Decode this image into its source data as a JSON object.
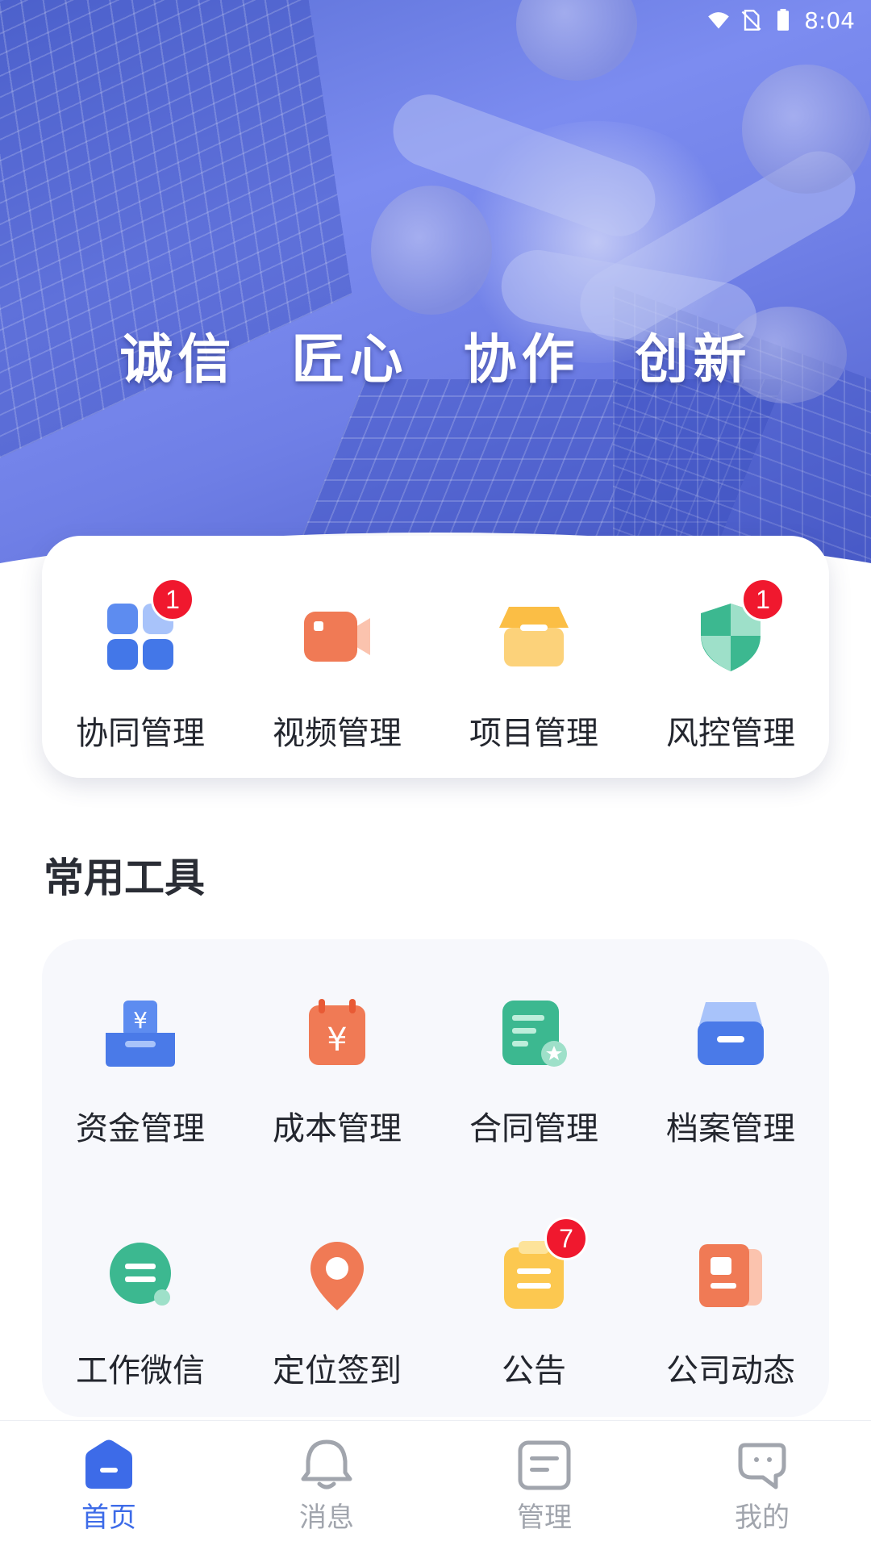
{
  "status_bar": {
    "time": "8:04"
  },
  "banner": {
    "slogan": "诚信 匠心 协作 创新"
  },
  "top_card": {
    "items": [
      {
        "label": "协同管理",
        "icon": "apps-grid-icon",
        "badge": "1"
      },
      {
        "label": "视频管理",
        "icon": "video-camera-icon"
      },
      {
        "label": "项目管理",
        "icon": "store-icon"
      },
      {
        "label": "风控管理",
        "icon": "shield-icon",
        "badge": "1"
      }
    ]
  },
  "section": {
    "title": "常用工具"
  },
  "tools": {
    "items": [
      {
        "label": "资金管理",
        "icon": "funds-yen-tray-icon"
      },
      {
        "label": "成本管理",
        "icon": "cost-yen-calendar-icon"
      },
      {
        "label": "合同管理",
        "icon": "contract-document-icon"
      },
      {
        "label": "档案管理",
        "icon": "archive-box-icon"
      },
      {
        "label": "工作微信",
        "icon": "chat-bubble-icon"
      },
      {
        "label": "定位签到",
        "icon": "location-pin-icon"
      },
      {
        "label": "公告",
        "icon": "notice-clipboard-icon",
        "badge": "7"
      },
      {
        "label": "公司动态",
        "icon": "company-news-icon"
      }
    ]
  },
  "bottom_nav": {
    "items": [
      {
        "label": "首页",
        "icon": "home-icon",
        "active": true
      },
      {
        "label": "消息",
        "icon": "bell-icon"
      },
      {
        "label": "管理",
        "icon": "management-card-icon"
      },
      {
        "label": "我的",
        "icon": "profile-icon"
      }
    ]
  },
  "colors": {
    "accent": "#3d6be8",
    "badge": "#f0182e",
    "banner": "#6f7fe6"
  }
}
